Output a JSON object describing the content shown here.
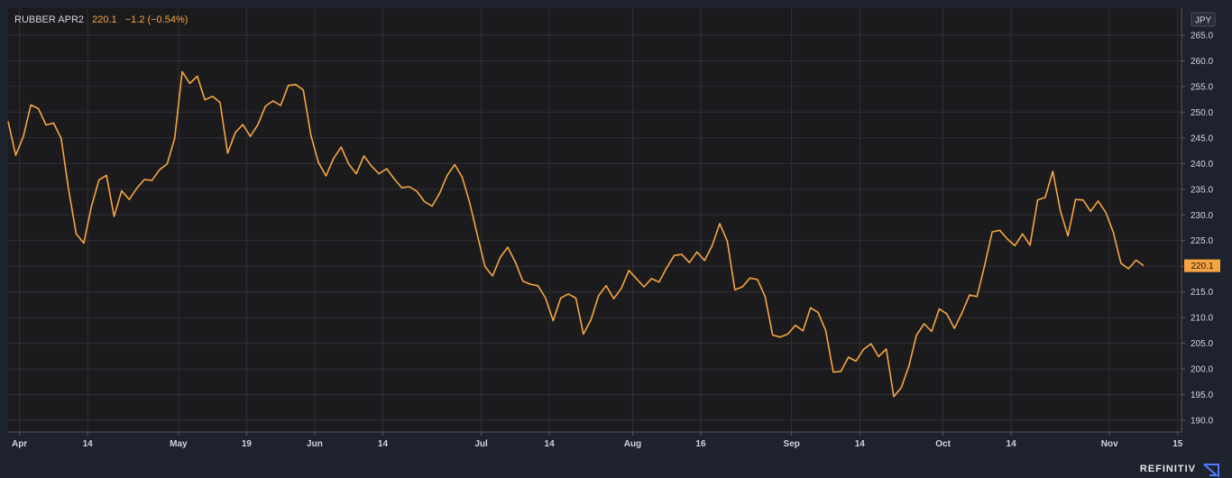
{
  "header": {
    "symbol": "RUBBER APR2",
    "last": "220.1",
    "change": "−1.2 (−0.54%)"
  },
  "currency_badge": "JPY",
  "last_price_label": "220.1",
  "brand": "REFINITIV",
  "colors": {
    "background": "#1e222d",
    "plot_background": "#1b1b1d",
    "line": "#f7a541",
    "grid": "#2f3136",
    "axis_text": "#d1d4dc"
  },
  "chart_data": {
    "type": "line",
    "title": "",
    "xlabel": "",
    "ylabel": "",
    "ylim": [
      187.5,
      267.5
    ],
    "yticks": [
      190.0,
      195.0,
      200.0,
      205.0,
      210.0,
      215.0,
      220.0,
      225.0,
      230.0,
      235.0,
      240.0,
      245.0,
      250.0,
      255.0,
      260.0,
      265.0
    ],
    "ytick_labels": [
      "190.0",
      "195.0",
      "200.0",
      "205.0",
      "210.0",
      "215.0",
      "220.0",
      "225.0",
      "230.0",
      "235.0",
      "240.0",
      "245.0",
      "250.0",
      "255.0",
      "260.0",
      "265.0"
    ],
    "xticks": [
      {
        "label": "Apr",
        "idx": 1.5
      },
      {
        "label": "14",
        "idx": 10.5
      },
      {
        "label": "May",
        "idx": 22.5
      },
      {
        "label": "19",
        "idx": 31.5
      },
      {
        "label": "Jun",
        "idx": 40.5
      },
      {
        "label": "14",
        "idx": 49.5
      },
      {
        "label": "Jul",
        "idx": 62.5
      },
      {
        "label": "14",
        "idx": 71.5
      },
      {
        "label": "Aug",
        "idx": 82.5
      },
      {
        "label": "16",
        "idx": 91.5
      },
      {
        "label": "Sep",
        "idx": 103.5
      },
      {
        "label": "14",
        "idx": 112.5
      },
      {
        "label": "Oct",
        "idx": 123.5
      },
      {
        "label": "14",
        "idx": 132.5
      },
      {
        "label": "Nov",
        "idx": 145.5
      },
      {
        "label": "15",
        "idx": 154.5
      }
    ],
    "grid": true,
    "series": [
      {
        "values": [
          248.2,
          241.6,
          245.2,
          251.4,
          250.7,
          247.5,
          247.9,
          244.9,
          234.9,
          226.3,
          224.5,
          231.6,
          236.8,
          237.7,
          229.7,
          234.7,
          233.0,
          235.2,
          236.9,
          236.7,
          238.8,
          239.9,
          244.9,
          257.9,
          255.6,
          257.0,
          252.4,
          253.1,
          251.9,
          242.0,
          246.0,
          247.6,
          245.3,
          247.6,
          251.2,
          252.2,
          251.3,
          255.2,
          255.4,
          254.3,
          245.5,
          240.2,
          237.6,
          241.0,
          243.2,
          239.9,
          238.0,
          241.5,
          239.5,
          238.0,
          239.0,
          237.0,
          235.3,
          235.5,
          234.6,
          232.6,
          231.7,
          234.2,
          237.7,
          239.8,
          237.3,
          232.2,
          226.0,
          219.9,
          218.1,
          221.7,
          223.7,
          220.8,
          217.1,
          216.5,
          216.2,
          213.8,
          209.4,
          213.8,
          214.6,
          213.8,
          206.8,
          209.6,
          214.3,
          216.2,
          213.7,
          215.7,
          219.2,
          217.6,
          216.0,
          217.6,
          216.9,
          219.7,
          222.1,
          222.3,
          220.7,
          222.8,
          221.1,
          224.0,
          228.3,
          224.9,
          215.4,
          216.0,
          217.7,
          217.4,
          214.1,
          206.6,
          206.2,
          206.8,
          208.5,
          207.4,
          211.9,
          211.0,
          207.5,
          199.4,
          199.5,
          202.3,
          201.5,
          203.8,
          204.9,
          202.4,
          203.9,
          194.6,
          196.4,
          200.6,
          206.6,
          208.8,
          207.3,
          211.7,
          210.7,
          207.9,
          210.9,
          214.4,
          214.1,
          220.1,
          226.7,
          227.0,
          225.3,
          224.0,
          226.3,
          224.1,
          232.9,
          233.4,
          238.5,
          230.8,
          225.9,
          233.0,
          232.9,
          230.7,
          232.7,
          230.5,
          226.6,
          220.6,
          219.5,
          221.2,
          220.1
        ]
      }
    ]
  }
}
